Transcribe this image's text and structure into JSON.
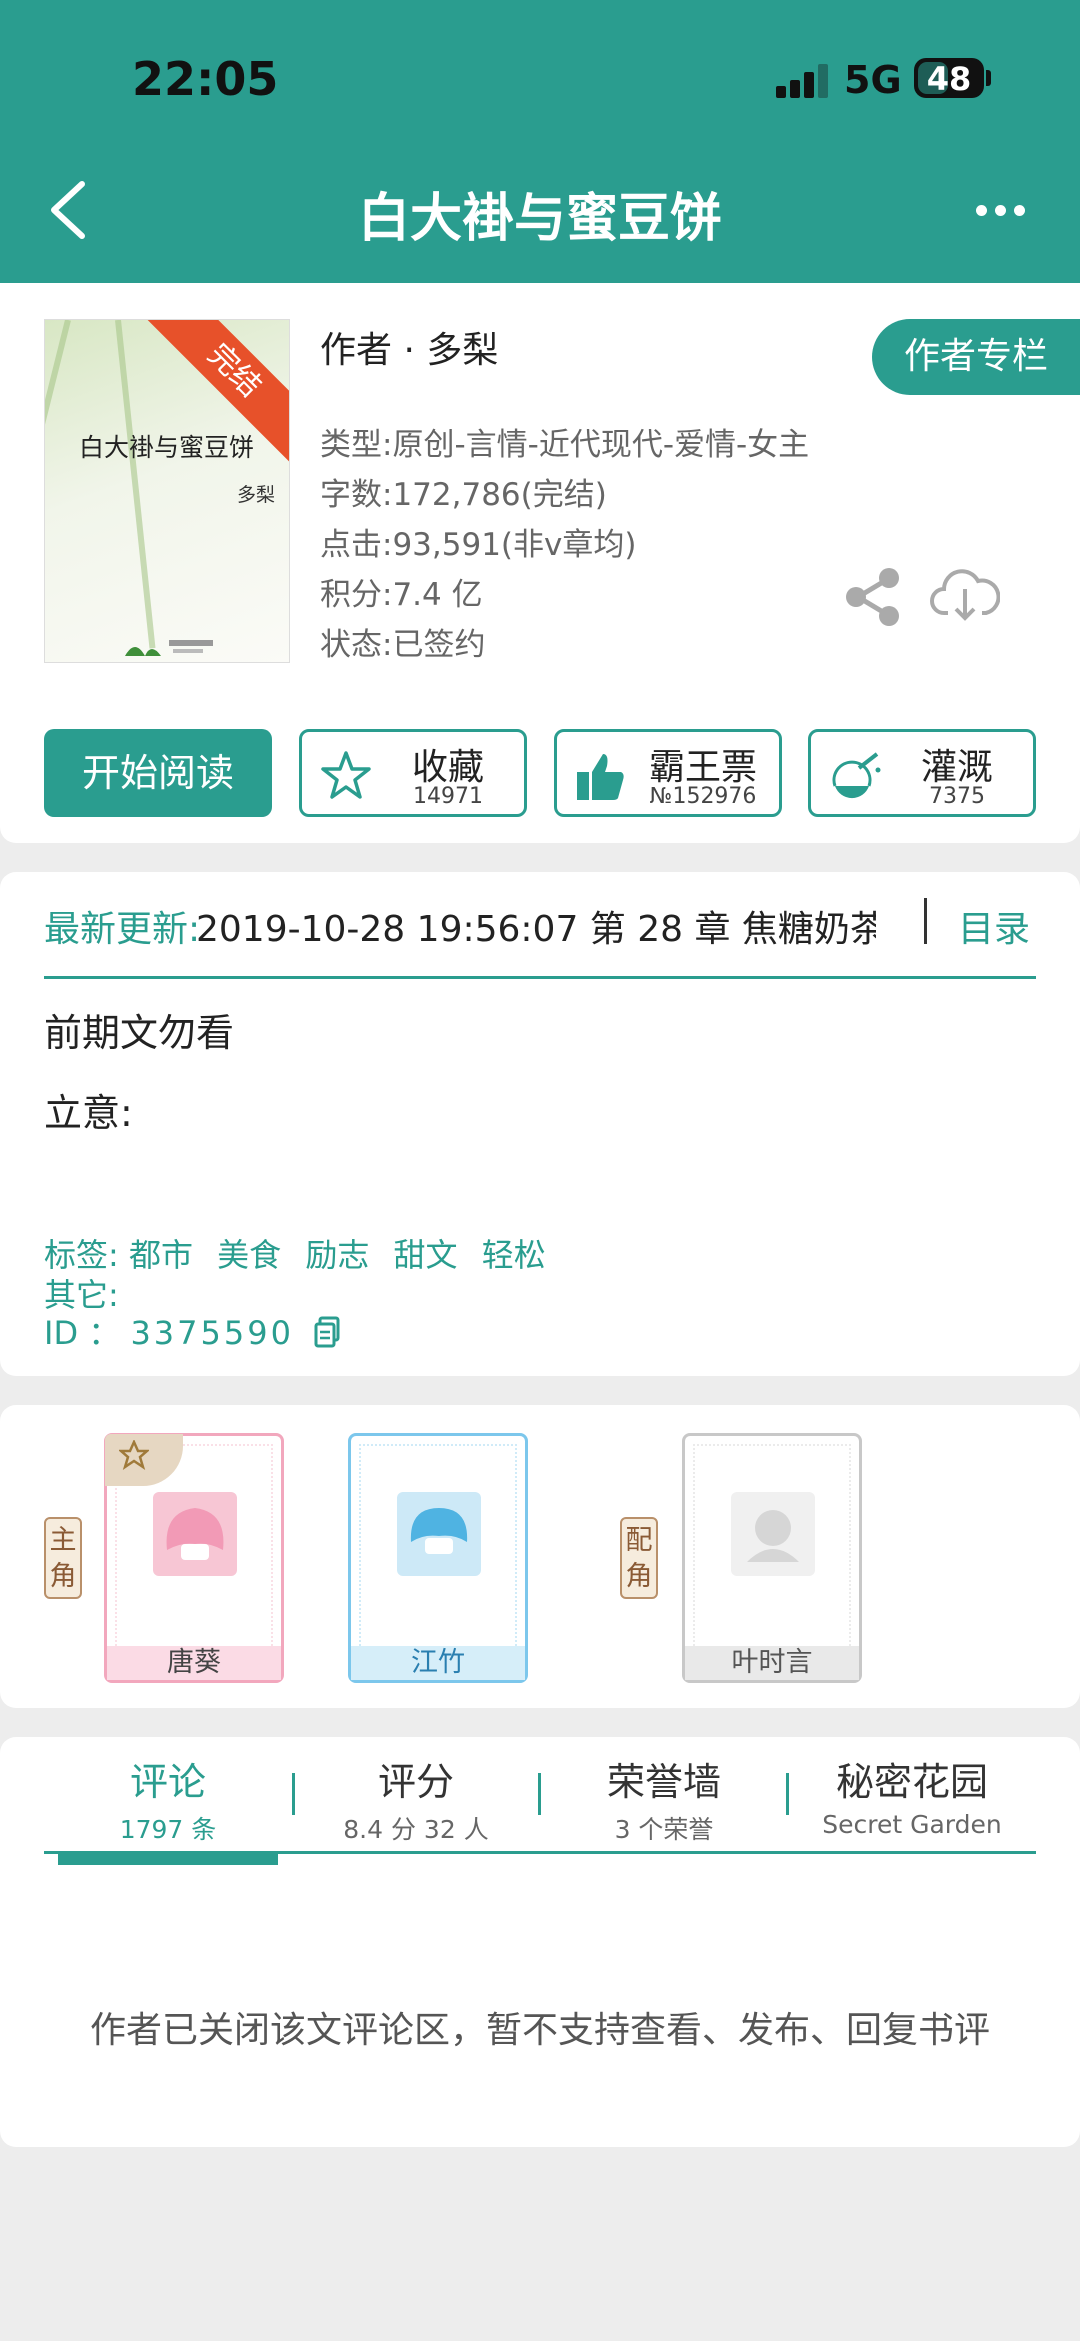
{
  "status_bar": {
    "time": "22:05",
    "network": "5G",
    "battery": "48"
  },
  "header": {
    "title": "白大褂与蜜豆饼"
  },
  "book": {
    "cover": {
      "title": "白大褂与蜜豆饼",
      "author": "多梨",
      "badge": "完结"
    },
    "author_line": "作者 · 多梨",
    "author_column_button": "作者专栏",
    "meta": [
      "类型:原创-言情-近代现代-爱情-女主",
      "字数:172,786(完结)",
      "点击:93,591(非v章均)",
      "积分:7.4 亿",
      "状态:已签约"
    ]
  },
  "actions": {
    "read": "开始阅读",
    "collect": {
      "label": "收藏",
      "count": "14971"
    },
    "vote": {
      "label": "霸王票",
      "count": "№152976"
    },
    "water": {
      "label": "灌溉",
      "count": "7375"
    }
  },
  "update": {
    "label": "最新更新:",
    "text": "2019-10-28 19:56:07   第 28 章  焦糖奶茶",
    "catalog": "目录"
  },
  "intro": {
    "line1": "前期文勿看",
    "line2": "立意:"
  },
  "tags": {
    "label": "标签:",
    "items": [
      "都市",
      "美食",
      "励志",
      "甜文",
      "轻松"
    ],
    "other_label": "其它:",
    "id_label": "ID  ：",
    "id_value": "3375590"
  },
  "characters": {
    "main_role": "主角",
    "support_role": "配角",
    "items": [
      {
        "name": "唐葵"
      },
      {
        "name": "江竹"
      },
      {
        "name": "叶时言"
      }
    ]
  },
  "tabs": [
    {
      "label": "评论",
      "sub": "1797 条"
    },
    {
      "label": "评分",
      "sub": "8.4 分 32 人"
    },
    {
      "label": "荣誉墙",
      "sub": "3 个荣誉"
    },
    {
      "label": "秘密花园",
      "sub": "Secret Garden"
    }
  ],
  "comments_closed": "作者已关闭该文评论区，暂不支持查看、发布、回复书评",
  "colors": {
    "accent": "#2a9d8f",
    "badge": "#e7512a",
    "pink": "#f2a7bd",
    "blue": "#7cc7ec",
    "gray": "#c8c8c8"
  }
}
